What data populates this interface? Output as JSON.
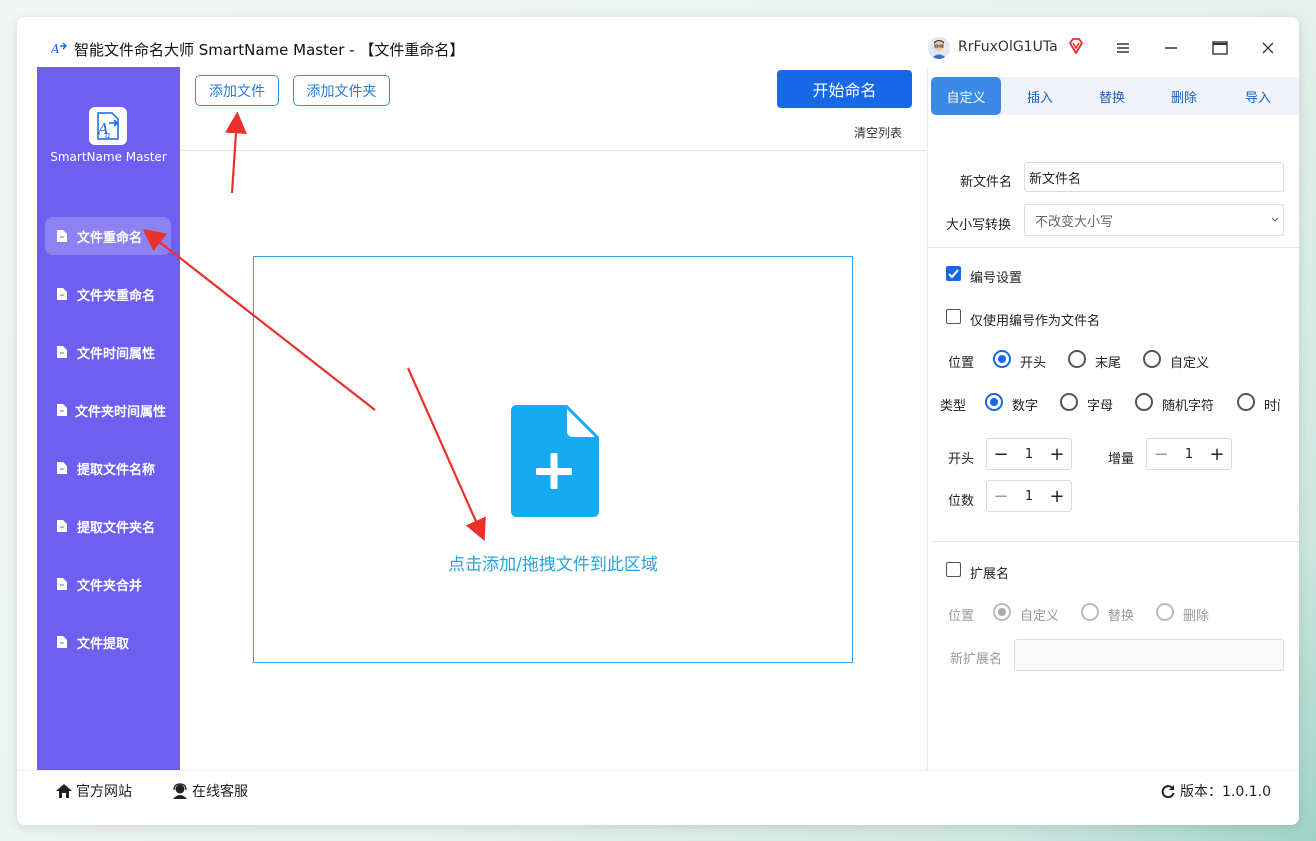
{
  "window": {
    "title": "智能文件命名大师 SmartName Master - 【文件重命名】",
    "user_name": "RrFuxOlG1UTa"
  },
  "sidebar": {
    "logo_text": "SmartName Master",
    "items": [
      {
        "label": "文件重命名"
      },
      {
        "label": "文件夹重命名"
      },
      {
        "label": "文件时间属性"
      },
      {
        "label": "文件夹时间属性"
      },
      {
        "label": "提取文件名称"
      },
      {
        "label": "提取文件夹名"
      },
      {
        "label": "文件夹合并"
      },
      {
        "label": "文件提取"
      }
    ]
  },
  "toolbar": {
    "add_file": "添加文件",
    "add_folder": "添加文件夹",
    "start": "开始命名",
    "clear": "清空列表"
  },
  "dropzone": {
    "hint": "点击添加/拖拽文件到此区域"
  },
  "tabs": [
    "自定义",
    "插入",
    "替换",
    "删除",
    "导入"
  ],
  "form": {
    "new_name_label": "新文件名",
    "new_name_value": "新文件名",
    "case_label": "大小写转换",
    "case_value": "不改变大小写",
    "numbering_label": "编号设置",
    "only_number_label": "仅使用编号作为文件名",
    "position_label": "位置",
    "position_options": [
      "开头",
      "末尾",
      "自定义"
    ],
    "type_label": "类型",
    "type_options": [
      "数字",
      "字母",
      "随机字符",
      "时间"
    ],
    "start_label": "开头",
    "start_value": "1",
    "increment_label": "增量",
    "increment_value": "1",
    "digits_label": "位数",
    "digits_value": "1",
    "ext_label": "扩展名",
    "ext_position_label": "位置",
    "ext_options": [
      "自定义",
      "替换",
      "删除"
    ],
    "new_ext_label": "新扩展名",
    "new_ext_value": ""
  },
  "footer": {
    "website": "官方网站",
    "support": "在线客服",
    "version": "版本：1.0.1.0"
  },
  "colors": {
    "sidebar": "#6f5ff0",
    "primary": "#1767e6",
    "drop_border": "#3a9ee2",
    "drop_text": "#27a3dd",
    "annotation": "#e8322b"
  }
}
